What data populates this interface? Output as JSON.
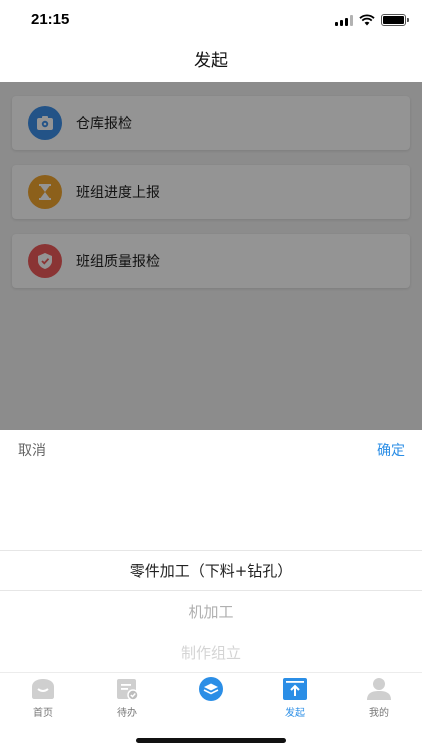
{
  "status_bar": {
    "time": "21:15"
  },
  "header": {
    "title": "发起"
  },
  "cards": [
    {
      "label": "仓库报检",
      "icon": "gear-icon",
      "color": "#3d8fe8"
    },
    {
      "label": "班组进度上报",
      "icon": "hourglass-icon",
      "color": "#f2a530"
    },
    {
      "label": "班组质量报检",
      "icon": "shield-icon",
      "color": "#ee5a5a"
    }
  ],
  "picker": {
    "cancel_label": "取消",
    "confirm_label": "确定",
    "options": [
      "零件加工（下料+钻孔）",
      "机加工",
      "制作组立"
    ],
    "selected_index": 0
  },
  "tabbar": {
    "tabs": [
      {
        "label": "首页",
        "icon": "home-icon"
      },
      {
        "label": "待办",
        "icon": "todo-icon"
      },
      {
        "label": "",
        "icon": "layers-icon"
      },
      {
        "label": "发起",
        "icon": "upload-icon"
      },
      {
        "label": "我的",
        "icon": "user-icon"
      }
    ],
    "active_index": 3
  },
  "colors": {
    "accent": "#2b8ee6"
  }
}
